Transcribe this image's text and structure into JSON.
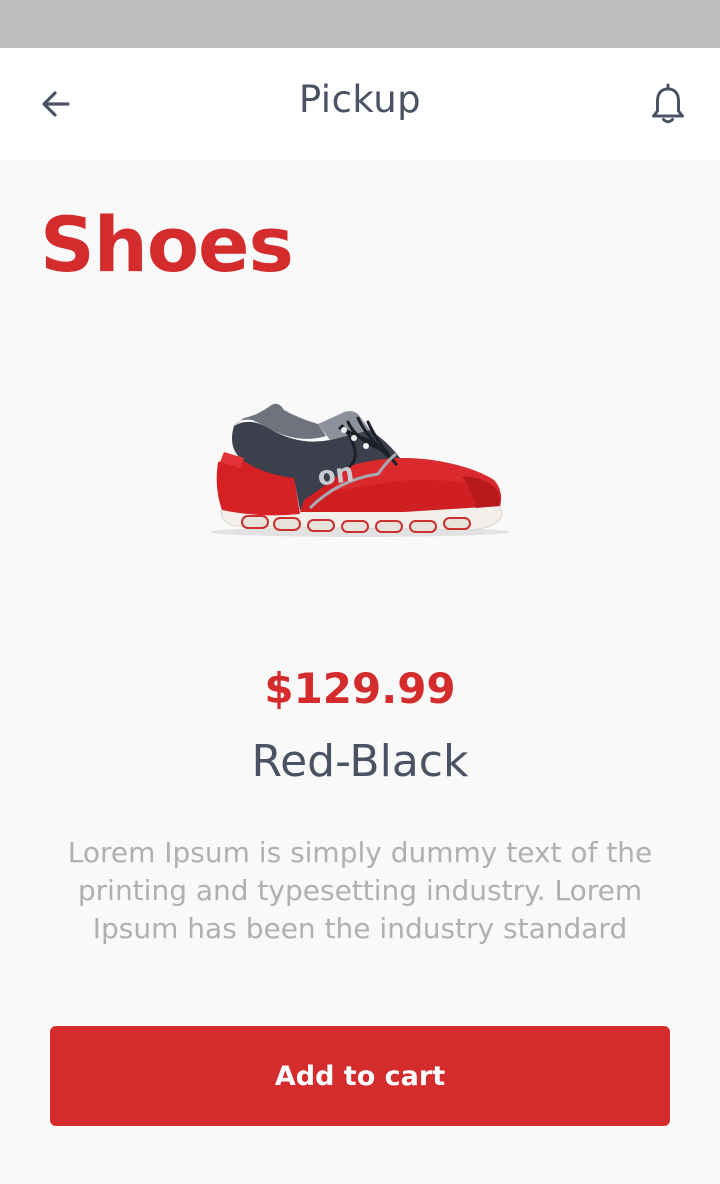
{
  "header": {
    "title": "Pickup",
    "back_icon": "arrow-left-icon",
    "notification_icon": "bell-icon"
  },
  "page": {
    "heading": "Shoes"
  },
  "product": {
    "image": "red-black-running-shoe",
    "logo_text": "on",
    "price": "$129.99",
    "variant": "Red-Black",
    "description": "Lorem Ipsum is simply dummy text of the printing and typesetting industry. Lorem Ipsum has been the industry standard"
  },
  "actions": {
    "add_to_cart_label": "Add to cart"
  },
  "colors": {
    "accent": "#d42b2d",
    "text_dark": "#4a5263",
    "text_muted": "#b0b0b0",
    "background": "#f9f9f9",
    "status_bar": "#bdbdbd"
  }
}
